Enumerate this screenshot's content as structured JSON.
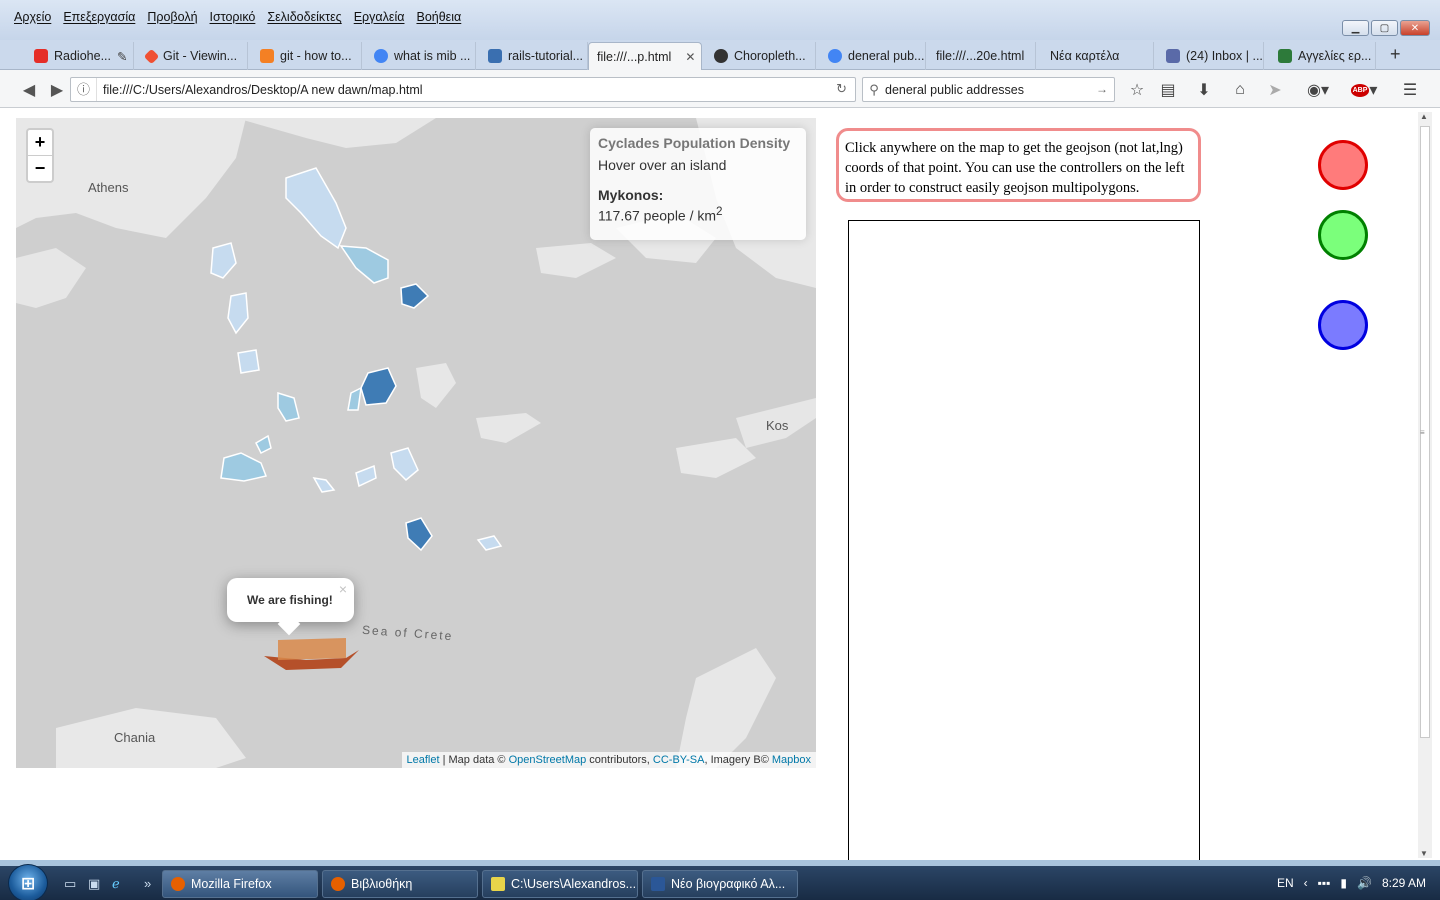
{
  "menu": [
    "Αρχείο",
    "Επεξεργασία",
    "Προβολή",
    "Ιστορικό",
    "Σελιδοδείκτες",
    "Εργαλεία",
    "Βοήθεια"
  ],
  "tabs": [
    {
      "label": "Radiohe...",
      "color": "#e52d27"
    },
    {
      "label": "Git - Viewin...",
      "color": "#f05033"
    },
    {
      "label": "git - how to...",
      "color": "#f48024"
    },
    {
      "label": "what is mib ...",
      "color": "#4285f4"
    },
    {
      "label": "rails-tutorial...",
      "color": "#3a6fb0"
    },
    {
      "label": "file:///...p.html",
      "color": "",
      "active": true
    },
    {
      "label": "Choropleth...",
      "color": "#333333"
    },
    {
      "label": "deneral pub...",
      "color": "#4285f4"
    },
    {
      "label": "file:///...20e.html",
      "color": ""
    },
    {
      "label": "Νέα καρτέλα",
      "color": ""
    },
    {
      "label": "(24) Inbox | ...",
      "color": "#5a6aa8"
    },
    {
      "label": "Αγγελίες ερ...",
      "color": "#2d7a3a"
    }
  ],
  "url": "file:///C:/Users/Alexandros/Desktop/A new dawn/map.html",
  "search": "deneral public addresses",
  "map": {
    "info": {
      "title": "Cyclades Population Density",
      "hover_hint": "Hover over an island",
      "island": "Mykonos:",
      "density_value": "117.67 people / km",
      "density_sup": "2"
    },
    "zoom_in": "+",
    "zoom_out": "−",
    "popup_text": "We are fishing!",
    "popup_close": "×",
    "labels": {
      "athens": "Athens",
      "kos": "Kos",
      "chania": "Chania",
      "sea": "Sea of Crete"
    },
    "attribution": {
      "leaflet": "Leaflet",
      "sep": " | Map data © ",
      "osm": "OpenStreetMap",
      "contrib": " contributors, ",
      "license": "CC-BY-SA",
      "imagery": ", Imagery B© ",
      "mapbox": "Mapbox"
    }
  },
  "hint_text": "Click anywhere on the map to get the geojson (not lat,lng) coords of that point. You can use the controllers on the left in order to construct easily geojson multipolygons.",
  "controls": {
    "red": "#ff7b7b",
    "green": "#7bff7b",
    "blue": "#7b7bff"
  },
  "taskbar": {
    "items": [
      "Mozilla Firefox",
      "Βιβλιοθήκη",
      "C:\\Users\\Alexandros...",
      "Νέο βιογραφικό Αλ..."
    ],
    "lang": "EN",
    "time": "8:29 AM"
  }
}
